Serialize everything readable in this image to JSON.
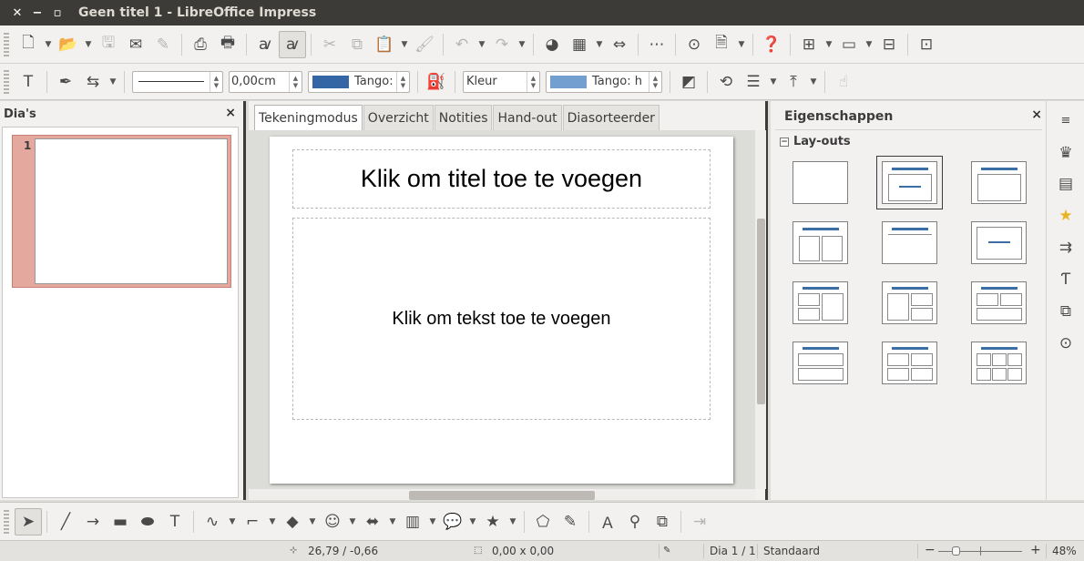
{
  "window": {
    "title": "Geen titel 1 - LibreOffice Impress",
    "close": "✕",
    "minimize": "−",
    "maximize": "▫"
  },
  "toolbar_line": {
    "width_value": "0,00cm",
    "line_color_label": "Tango:",
    "line_color": "#3465a4",
    "area_style_label": "Kleur",
    "area_color_label": "Tango: h",
    "area_color": "#729fcf"
  },
  "slide_pane": {
    "title": "Dia's",
    "close": "×",
    "slides": [
      {
        "number": "1"
      }
    ]
  },
  "view_tabs": [
    "Tekeningmodus",
    "Overzicht",
    "Notities",
    "Hand-out",
    "Diasorteerder"
  ],
  "slide": {
    "title_placeholder": "Klik om titel toe te voegen",
    "body_placeholder": "Klik om tekst toe te voegen"
  },
  "properties": {
    "title": "Eigenschappen",
    "close": "×",
    "section": "Lay-outs",
    "section_toggle": "−"
  },
  "statusbar": {
    "position": "26,79 / -0,66",
    "size": "0,00 x 0,00",
    "slide": "Dia 1 / 1",
    "master": "Standaard",
    "zoom_minus": "−",
    "zoom_plus": "+",
    "zoom": "48%"
  }
}
